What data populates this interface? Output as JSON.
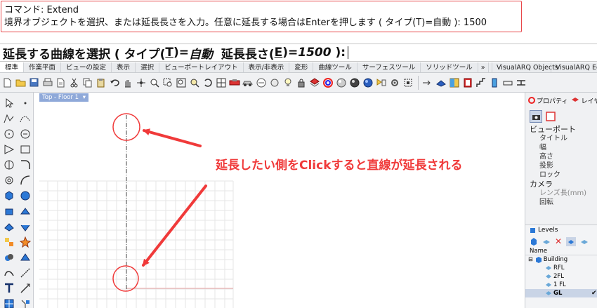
{
  "command_history": {
    "line1": "コマンド: Extend",
    "line2": "境界オブジェクトを選択、または延長長さを入力。任意に延長する場合はEnterを押します ( タイプ(T)=自動 ): 1500"
  },
  "command_prompt": {
    "prefix": "延長する曲線を選択 ( タイプ(",
    "type_key": "T",
    "type_eq": ")=",
    "type_value": "自動",
    "length_label": "  延長長さ(",
    "length_key": "E",
    "length_eq": ")=",
    "length_value": "1500",
    "suffix": " ):"
  },
  "tabs": [
    {
      "label": "標準"
    },
    {
      "label": "作業平面"
    },
    {
      "label": "ビューの設定"
    },
    {
      "label": "表示"
    },
    {
      "label": "選択"
    },
    {
      "label": "ビューポートレイアウト"
    },
    {
      "label": "表示/非表示"
    },
    {
      "label": "変形"
    },
    {
      "label": "曲線ツール"
    },
    {
      "label": "サーフェスツール"
    },
    {
      "label": "ソリッドツール"
    }
  ],
  "tabs_overflow": "»",
  "tabs_right": {
    "visualarq_objects": "VisualARQ Objects",
    "visualarq_edit": "VisualARQ Edit"
  },
  "viewport": {
    "title": "Top - Floor 1",
    "dropdown_glyph": "▾"
  },
  "annotation": {
    "text": "延長したい側をClickすると直線が延長される",
    "color": "#f03a3a"
  },
  "properties_panel": {
    "tab_properties": "プロパティ",
    "tab_layers": "レイヤ",
    "section_viewport": "ビューポート",
    "viewport_items": [
      "タイトル",
      "幅",
      "高さ",
      "投影",
      "ロック"
    ],
    "section_camera": "カメラ",
    "camera_items": [
      "レンズ長(mm)",
      "回転"
    ]
  },
  "levels_panel": {
    "title": "Levels",
    "column_name": "Name",
    "building": "Building",
    "levels": [
      {
        "name": "RFL",
        "selected": false
      },
      {
        "name": "2FL",
        "selected": false
      },
      {
        "name": "1 FL",
        "selected": false
      },
      {
        "name": "GL",
        "selected": true
      }
    ],
    "check_glyph": "✔"
  },
  "colors": {
    "accent_red": "#e8474a",
    "viewport_tab": "#8fa9d9",
    "grid_minor": "#e6e6e6",
    "grid_axis_red": "#e8a3a3"
  }
}
